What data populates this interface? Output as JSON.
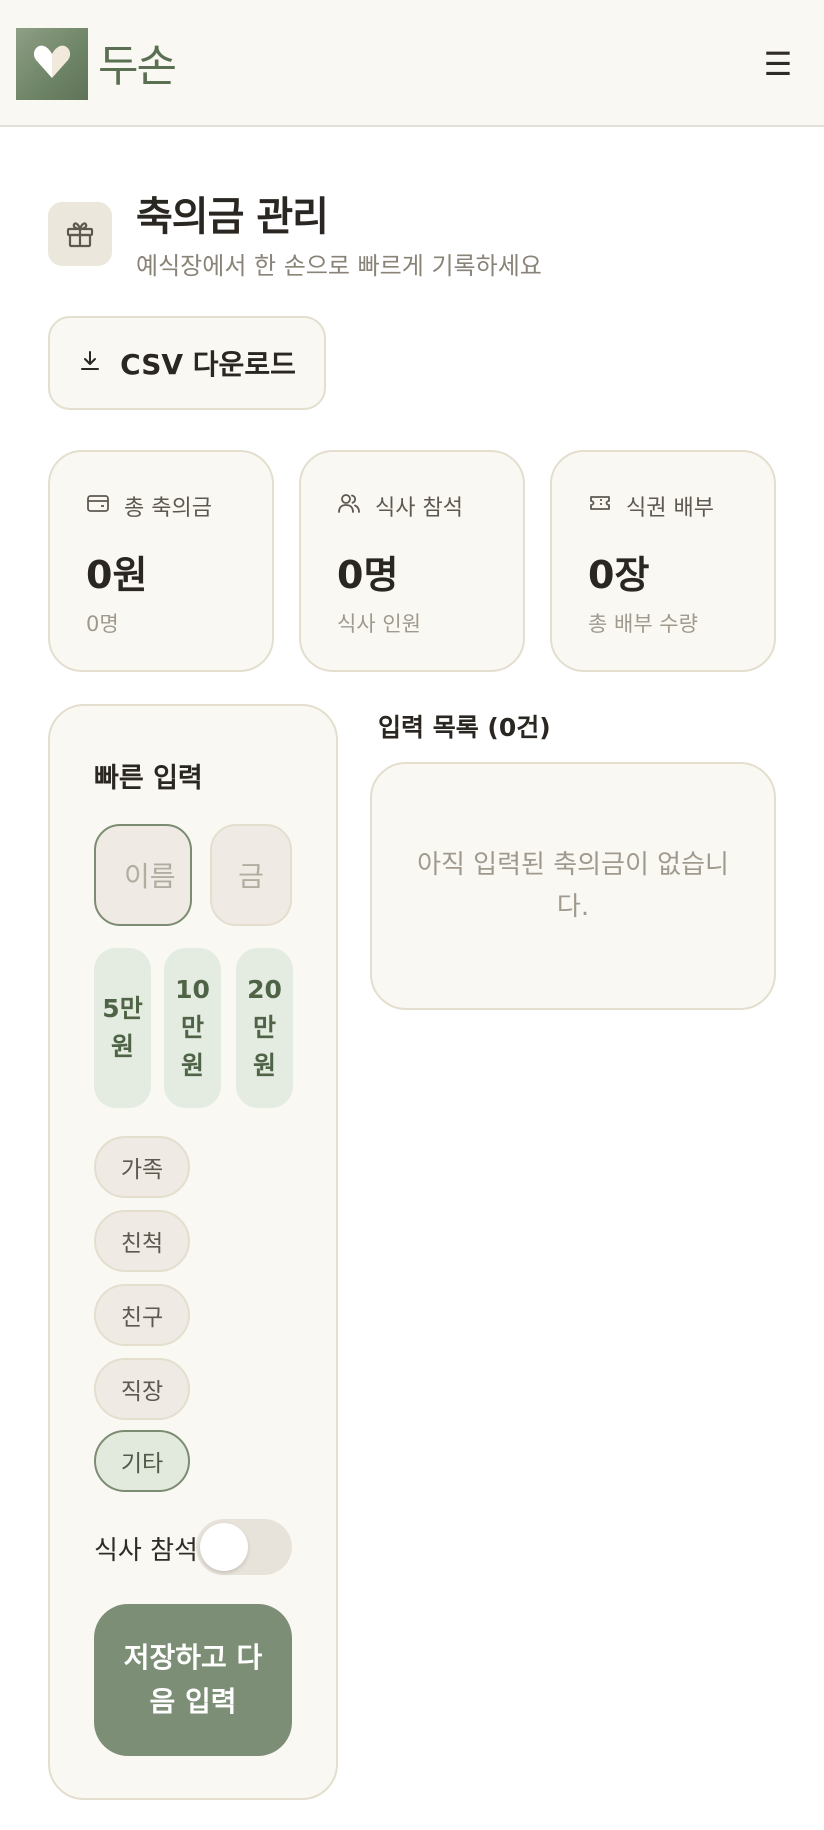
{
  "header": {
    "brand": "두손",
    "logo_icon": "heart-icon",
    "menu_icon": "hamburger-menu-icon",
    "menu_glyph": "☰"
  },
  "page": {
    "title": "축의금 관리",
    "subtitle": "예식장에서 한 손으로 빠르게 기록하세요",
    "icon": "gift-icon"
  },
  "toolbar": {
    "csv_label": "CSV 다운로드",
    "csv_icon": "download-icon"
  },
  "stats": [
    {
      "label": "총 축의금",
      "value": "0원",
      "sub": "0명",
      "icon": "wallet-icon"
    },
    {
      "label": "식사 참석",
      "value": "0명",
      "sub": "식사 인원",
      "icon": "users-icon"
    },
    {
      "label": "식권 배부",
      "value": "0장",
      "sub": "총 배부 수량",
      "icon": "ticket-icon"
    }
  ],
  "quick_entry": {
    "title": "빠른 입력",
    "name_placeholder": "이름",
    "amount_placeholder": "금",
    "amount_buttons": [
      "5만원",
      "10만원",
      "20만원"
    ],
    "relations": [
      "가족",
      "친척",
      "친구",
      "직장",
      "기타"
    ],
    "selected_relation": "기타",
    "meal_label": "식사 참석",
    "meal_on": false,
    "save_label": "저장하고 다음 입력"
  },
  "list": {
    "title": "입력 목록 (0건)",
    "empty_text": "아직 입력된 축의금이 없습니다."
  },
  "colors": {
    "accent": "#7d8e76",
    "background": "#faf8f3",
    "border": "#e4decf"
  }
}
